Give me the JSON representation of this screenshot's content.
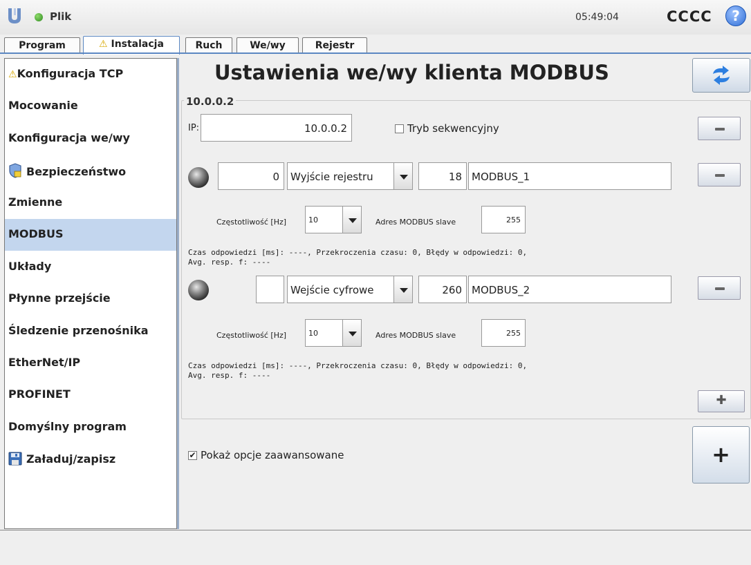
{
  "header": {
    "app_menu": "Plik",
    "clock": "05:49:04",
    "robot_name": "CCCC",
    "help_glyph": "?"
  },
  "tabs": [
    {
      "label": "Program"
    },
    {
      "label": "Instalacja",
      "warning": true
    },
    {
      "label": "Ruch"
    },
    {
      "label": "We/wy"
    },
    {
      "label": "Rejestr"
    }
  ],
  "sidebar": {
    "selected": "MODBUS",
    "items": [
      {
        "label": "Konfiguracja TCP",
        "icon": "warning-icon"
      },
      {
        "label": "Mocowanie"
      },
      {
        "label": "Konfiguracja we/wy"
      },
      {
        "label": "Bezpieczeństwo",
        "icon": "shield-icon"
      },
      {
        "label": "Zmienne"
      },
      {
        "label": "MODBUS"
      },
      {
        "label": "Układy"
      },
      {
        "label": "Płynne przejście"
      },
      {
        "label": "Śledzenie przenośnika"
      },
      {
        "label": "EtherNet/IP"
      },
      {
        "label": "PROFINET"
      },
      {
        "label": "Domyślny program"
      },
      {
        "label": "Załaduj/zapisz",
        "icon": "floppy-icon"
      }
    ]
  },
  "main": {
    "title": "Ustawienia we/wy klienta MODBUS",
    "client": {
      "group_title": "10.0.0.2",
      "ip_label": "IP:",
      "ip_value": "10.0.0.2",
      "sequential_label": "Tryb sekwencyjny",
      "sequential_checked": false
    },
    "signals": [
      {
        "address": "0",
        "type": "Wyjście rejestru",
        "value": "18",
        "name": "MODBUS_1",
        "freq_label": "Częstotliwość [Hz]",
        "freq_value": "10",
        "slave_label": "Adres MODBUS slave",
        "slave_value": "255",
        "stats_line1": "Czas odpowiedzi [ms]: ----, Przekroczenia czasu: 0, Błędy w odpowiedzi: 0,",
        "stats_line2": "Avg. resp. f: ----"
      },
      {
        "address": "",
        "type": "Wejście cyfrowe",
        "value": "260",
        "name": "MODBUS_2",
        "freq_label": "Częstotliwość [Hz]",
        "freq_value": "10",
        "slave_label": "Adres MODBUS slave",
        "slave_value": "255",
        "stats_line1": "Czas odpowiedzi [ms]: ----, Przekroczenia czasu: 0, Błędy w odpowiedzi: 0,",
        "stats_line2": "Avg. resp. f: ----"
      }
    ],
    "advanced_label": "Pokaż opcje zaawansowane",
    "advanced_checked": true,
    "add_signal_glyph": "✚",
    "add_client_glyph": "+"
  },
  "colors": {
    "accent": "#5b87c2",
    "selected_bg": "#c3d6ee"
  }
}
